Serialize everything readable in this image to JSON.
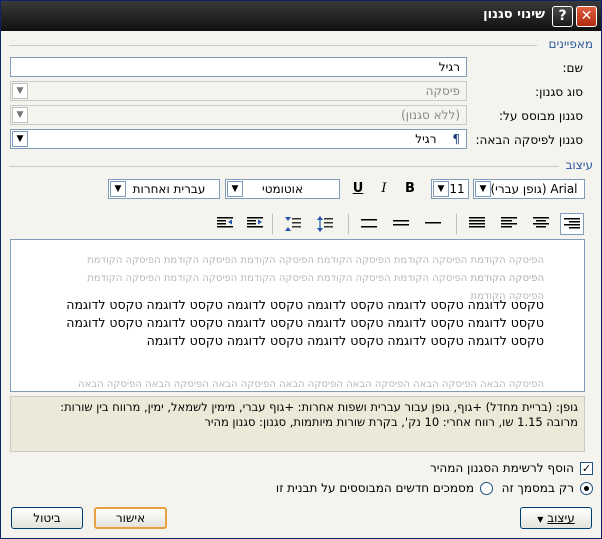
{
  "window": {
    "title": "שינוי סגנון",
    "help_glyph": "?",
    "close_glyph": "✕"
  },
  "properties": {
    "section_label": "מאפיינים",
    "name_label": "שם:",
    "name_value": "רגיל",
    "style_type_label": "סוג סגנון:",
    "style_type_value": "פיסקה",
    "based_on_label": "סגנון מבוסס על:",
    "based_on_value": "(ללא סגנון)",
    "next_style_label": "סגנון לפיסקה הבאה:",
    "next_style_value": "רגיל",
    "next_style_glyph": "¶"
  },
  "formatting": {
    "section_label": "עיצוב",
    "font_value": "(גופן עברי) Arial",
    "size_value": "11",
    "bold": "B",
    "italic": "I",
    "underline": "U",
    "color_value": "אוטומטי",
    "script_value": "עברית ואחרות"
  },
  "preview": {
    "prev_para_line": "הפיסקה הקודמת הפיסקה הקודמת הפיסקה הקודמת הפיסקה הקודמת הפיסקה הקודמת הפיסקה הקודמת הפיסקה הקודמת",
    "sample_text": "טקסט לדוגמה טקסט לדוגמה טקסט לדוגמה טקסט לדוגמה טקסט לדוגמה טקסט לדוגמה טקסט לדוגמה טקסט לדוגמה טקסט לדוגמה טקסט לדוגמה טקסט לדוגמה טקסט לדוגמה טקסט לדוגמה טקסט לדוגמה טקסט לדוגמה טקסט לדוגמה טקסט לדוגמה",
    "next_para_line": "הפיסקה הבאה הפיסקה הבאה הפיסקה הבאה הפיסקה הבאה הפיסקה הבאה הפיסקה הבאה הפיסקה הבאה הפיסקה הבאה"
  },
  "description": {
    "line1": "גופן: (בריית מחדל) +גוף, גופן עבור עברית ושפות אחרות: +גוף עברי, מימין לשמאל, ימין, מרווח בין שורות:",
    "line2": "מרובה 1.15 שו, רווח אחרי: 10 נק', בקרת שורות מיותמות, סגנון: סגנון מהיר"
  },
  "options": {
    "add_quick_style": "הוסף לרשימת הסגנון המהיר",
    "only_this_doc": "רק במסמך זה",
    "new_docs": "מסמכים חדשים המבוססים על תבנית זו"
  },
  "buttons": {
    "format": "עיצוב",
    "ok": "אישור",
    "cancel": "ביטול"
  }
}
